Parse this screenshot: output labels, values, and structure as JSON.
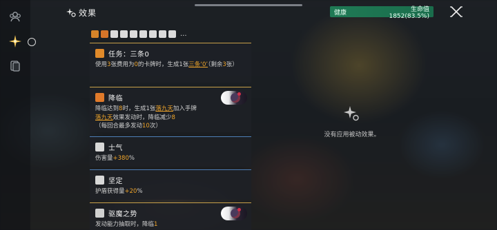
{
  "header": {
    "title": "效果"
  },
  "status": {
    "state": "健康",
    "hp": "生命值 1852(83.5%)"
  },
  "icon_row": {
    "icons": [
      {
        "name": "orange-card-icon",
        "color": "#e08a2a"
      },
      {
        "name": "orange-flame-icon",
        "color": "#e07a2a"
      },
      {
        "name": "morale-icon",
        "color": "#e6e6e6"
      },
      {
        "name": "shield-icon",
        "color": "#e6e6e6"
      },
      {
        "name": "exorcise-icon",
        "color": "#e6e6e6"
      },
      {
        "name": "burst-icon",
        "color": "#e6e6e6"
      },
      {
        "name": "burst-icon-2",
        "color": "#e6e6e6"
      },
      {
        "name": "burst-icon-3",
        "color": "#e6e6e6"
      },
      {
        "name": "burst-icon-4",
        "color": "#e6e6e6"
      }
    ],
    "more": "..."
  },
  "effects": [
    {
      "title": "任务：三条0",
      "icon": "task-card-icon",
      "desc_parts": [
        {
          "t": "使用",
          "c": ""
        },
        {
          "t": "3",
          "c": "o"
        },
        {
          "t": "张费用为",
          "c": ""
        },
        {
          "t": "0",
          "c": "o"
        },
        {
          "t": "的卡牌时，生成1张",
          "c": ""
        },
        {
          "t": "三条‘0’",
          "c": "u"
        },
        {
          "t": "（剩余",
          "c": ""
        },
        {
          "t": "3",
          "c": "o"
        },
        {
          "t": "张）",
          "c": ""
        }
      ]
    },
    {
      "title": "降临",
      "icon": "descend-icon",
      "desc_parts": [
        {
          "t": "降临达到",
          "c": ""
        },
        {
          "t": "8",
          "c": "o"
        },
        {
          "t": "时，生成1张",
          "c": ""
        },
        {
          "t": "落九天",
          "c": "u"
        },
        {
          "t": "加入手牌",
          "c": ""
        },
        {
          "t": "\n",
          "c": "br"
        },
        {
          "t": "落九天",
          "c": "u"
        },
        {
          "t": "效果发动时，降临减少",
          "c": ""
        },
        {
          "t": "8",
          "c": "o"
        },
        {
          "t": "\n",
          "c": "br"
        },
        {
          "t": "（每回合最多发动",
          "c": ""
        },
        {
          "t": "10",
          "c": "o"
        },
        {
          "t": "次）",
          "c": ""
        }
      ]
    },
    {
      "title": "士气",
      "icon": "morale-icon",
      "desc_parts": [
        {
          "t": "伤害量",
          "c": ""
        },
        {
          "t": "+380",
          "c": "o"
        },
        {
          "t": "%",
          "c": ""
        }
      ]
    },
    {
      "title": "坚定",
      "icon": "steadfast-icon",
      "desc_parts": [
        {
          "t": "护盾获得量",
          "c": ""
        },
        {
          "t": "+20",
          "c": "o"
        },
        {
          "t": "%",
          "c": ""
        }
      ]
    },
    {
      "title": "驱魔之势",
      "icon": "exorcise-card-icon",
      "desc_parts": [
        {
          "t": "发动能力抽取时，降临",
          "c": ""
        },
        {
          "t": "1",
          "c": "o"
        }
      ]
    }
  ],
  "empty_panel": {
    "text": "没有应用被动效果。"
  },
  "colors": {
    "accent_gold": "#c9a14a",
    "accent_blue": "#4e7fb8",
    "highlight": "#f0a52a",
    "status_green": "#1f7a55"
  }
}
